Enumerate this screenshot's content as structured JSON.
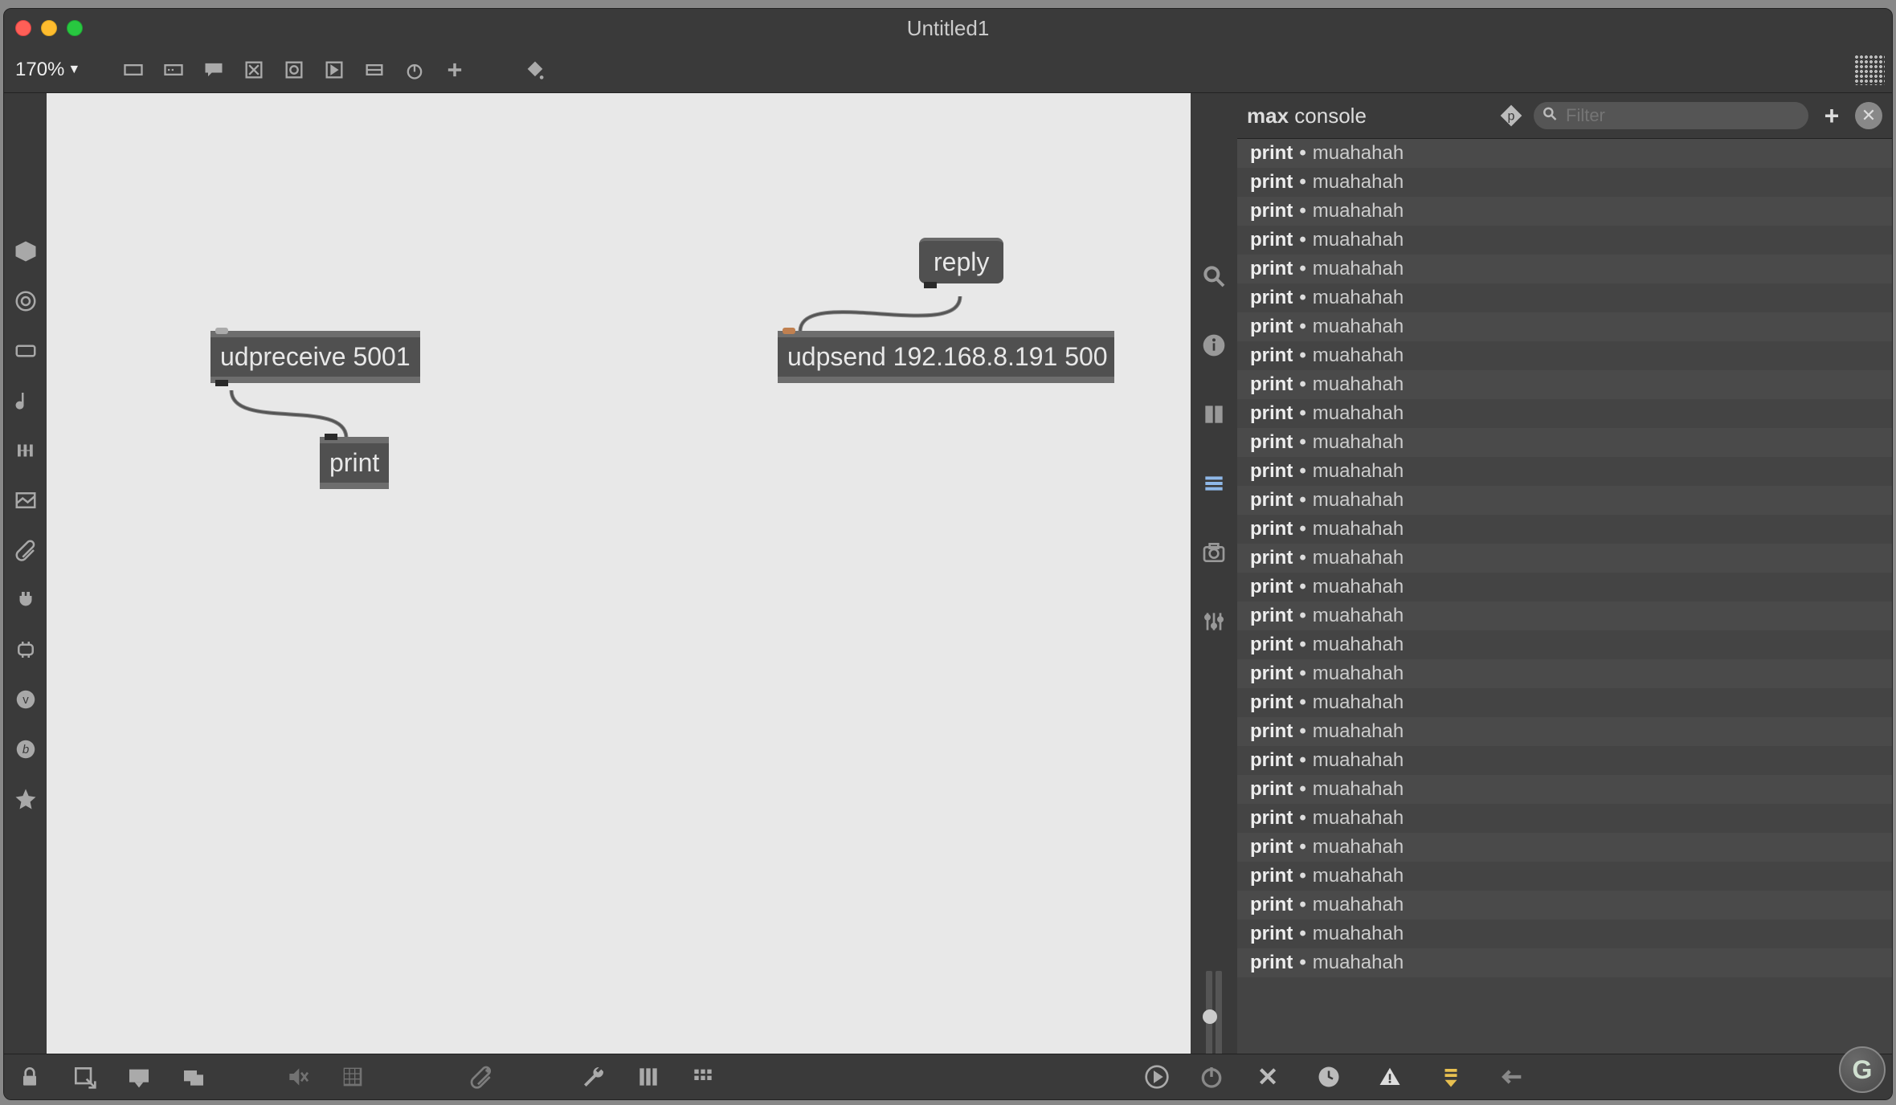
{
  "window": {
    "title": "Untitled1"
  },
  "toolbar": {
    "zoom_label": "170%"
  },
  "patch": {
    "boxes": {
      "msg_reply": "reply",
      "udpreceive": "udpreceive 5001",
      "udpsend": "udpsend 192.168.8.191 500",
      "print": "print"
    }
  },
  "console": {
    "app_label": "max",
    "section_label": "console",
    "filter_placeholder": "Filter",
    "entries": [
      {
        "src": "print",
        "msg": "muahahah"
      },
      {
        "src": "print",
        "msg": "muahahah"
      },
      {
        "src": "print",
        "msg": "muahahah"
      },
      {
        "src": "print",
        "msg": "muahahah"
      },
      {
        "src": "print",
        "msg": "muahahah"
      },
      {
        "src": "print",
        "msg": "muahahah"
      },
      {
        "src": "print",
        "msg": "muahahah"
      },
      {
        "src": "print",
        "msg": "muahahah"
      },
      {
        "src": "print",
        "msg": "muahahah"
      },
      {
        "src": "print",
        "msg": "muahahah"
      },
      {
        "src": "print",
        "msg": "muahahah"
      },
      {
        "src": "print",
        "msg": "muahahah"
      },
      {
        "src": "print",
        "msg": "muahahah"
      },
      {
        "src": "print",
        "msg": "muahahah"
      },
      {
        "src": "print",
        "msg": "muahahah"
      },
      {
        "src": "print",
        "msg": "muahahah"
      },
      {
        "src": "print",
        "msg": "muahahah"
      },
      {
        "src": "print",
        "msg": "muahahah"
      },
      {
        "src": "print",
        "msg": "muahahah"
      },
      {
        "src": "print",
        "msg": "muahahah"
      },
      {
        "src": "print",
        "msg": "muahahah"
      },
      {
        "src": "print",
        "msg": "muahahah"
      },
      {
        "src": "print",
        "msg": "muahahah"
      },
      {
        "src": "print",
        "msg": "muahahah"
      },
      {
        "src": "print",
        "msg": "muahahah"
      },
      {
        "src": "print",
        "msg": "muahahah"
      },
      {
        "src": "print",
        "msg": "muahahah"
      },
      {
        "src": "print",
        "msg": "muahahah"
      },
      {
        "src": "print",
        "msg": "muahahah"
      }
    ]
  }
}
